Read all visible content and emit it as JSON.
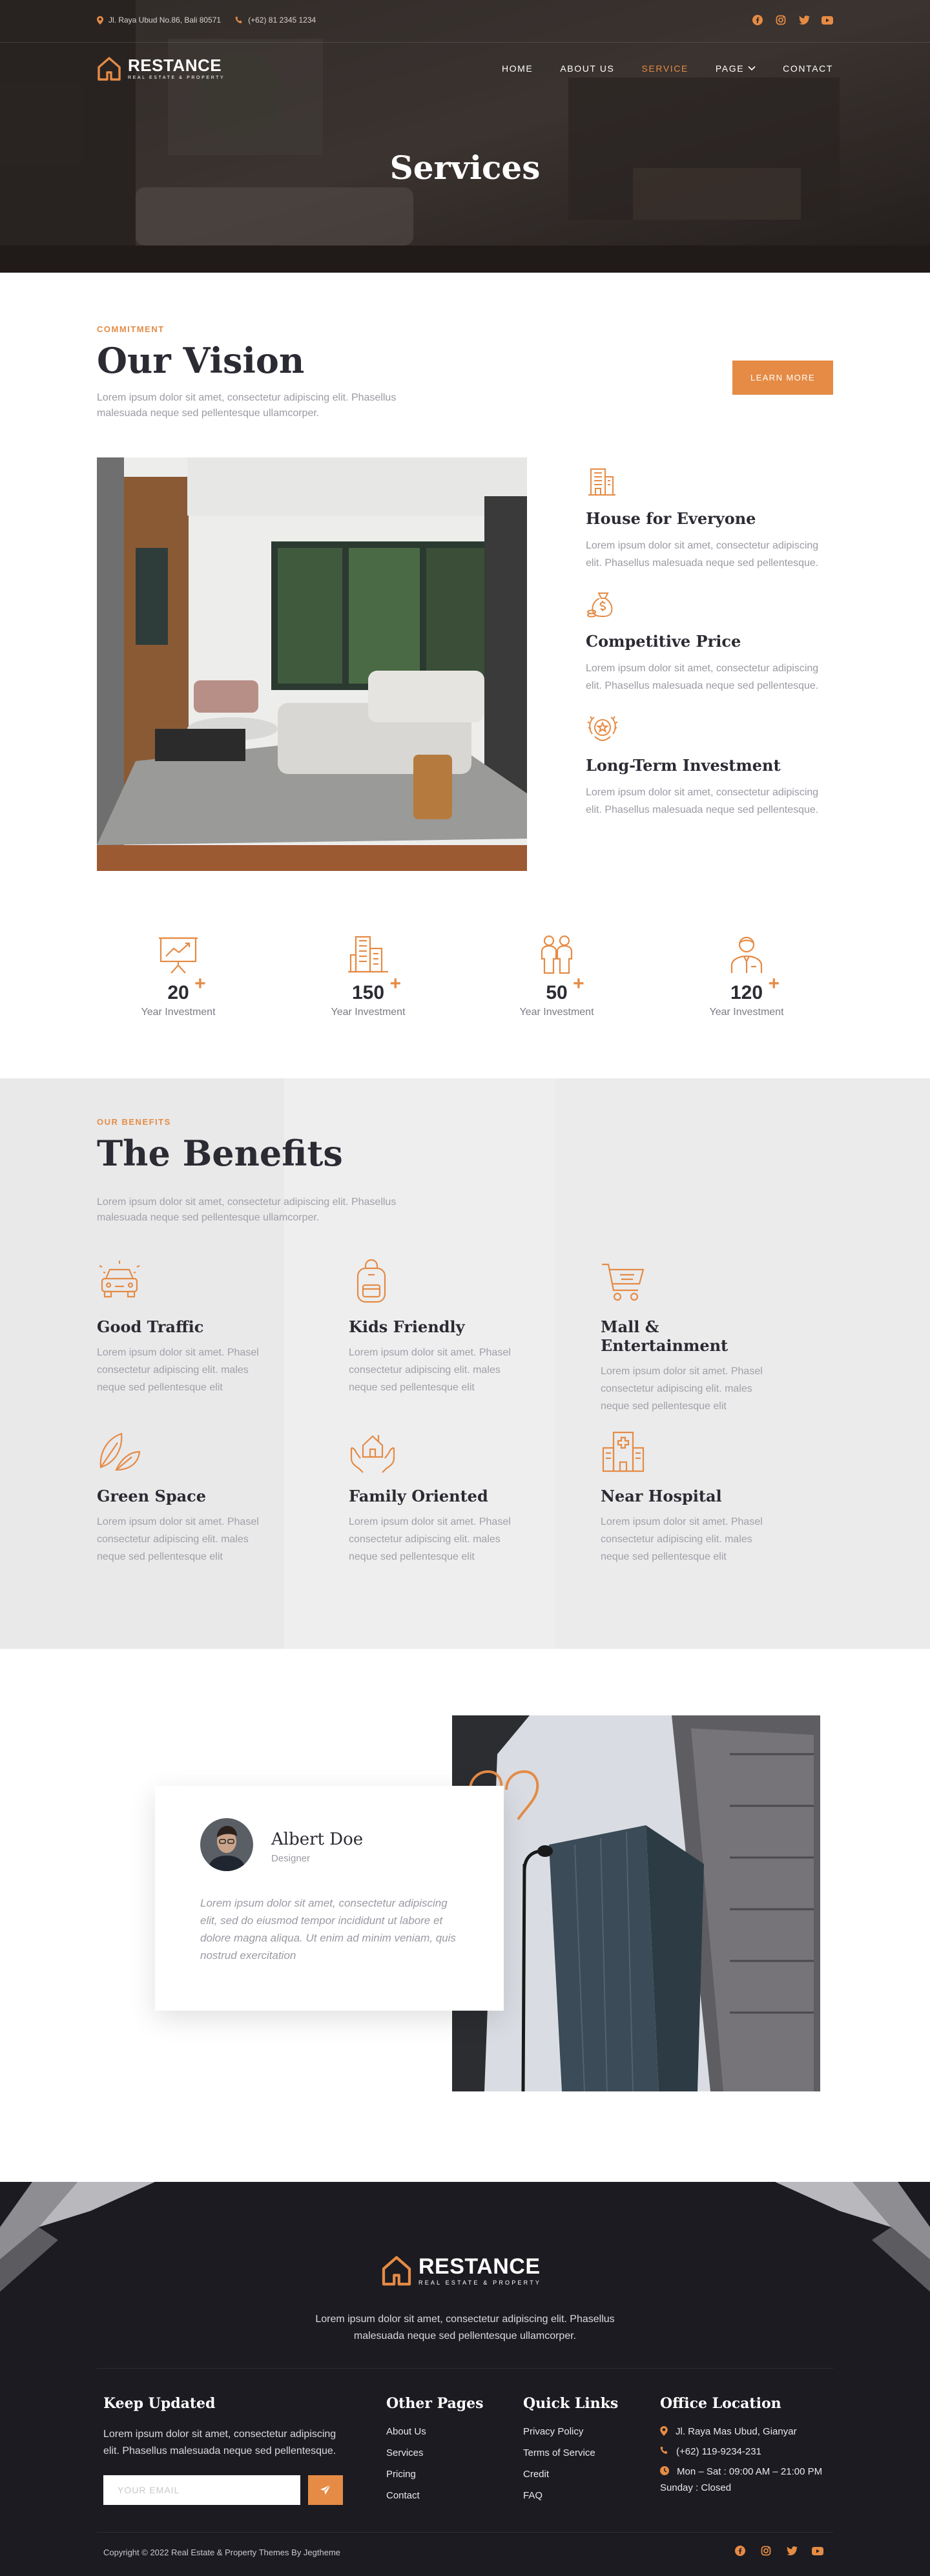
{
  "topbar": {
    "address": "Jl. Raya Ubud No.86, Bali 80571",
    "phone": "(+62) 81 2345 1234",
    "socials": [
      "facebook-icon",
      "instagram-icon",
      "twitter-icon",
      "youtube-icon"
    ]
  },
  "brand": {
    "name": "RESTANCE",
    "tagline": "REAL ESTATE & PROPERTY"
  },
  "nav": {
    "items": [
      {
        "label": "HOME"
      },
      {
        "label": "ABOUT US"
      },
      {
        "label": "SERVICE",
        "active": true
      },
      {
        "label": "PAGE",
        "dropdown": true
      },
      {
        "label": "CONTACT"
      }
    ]
  },
  "hero": {
    "title": "Services"
  },
  "vision": {
    "eyebrow": "COMMITMENT",
    "title": "Our Vision",
    "lead": "Lorem ipsum dolor sit amet, consectetur adipiscing elit. Phasellus malesuada neque sed pellentesque ullamcorper.",
    "button": "LEARN MORE",
    "features": [
      {
        "icon": "building-icon",
        "title": "House for Everyone",
        "text": "Lorem ipsum dolor sit amet, consectetur adipiscing elit. Phasellus malesuada neque sed pellentesque."
      },
      {
        "icon": "money-bag-icon",
        "title": "Competitive Price",
        "text": "Lorem ipsum dolor sit amet, consectetur adipiscing elit. Phasellus malesuada neque sed pellentesque."
      },
      {
        "icon": "award-icon",
        "title": "Long-Term Investment",
        "text": "Lorem ipsum dolor sit amet, consectetur adipiscing elit. Phasellus malesuada neque sed pellentesque."
      }
    ],
    "stats": [
      {
        "icon": "presentation-chart-icon",
        "value": "20",
        "label": "Year Investment"
      },
      {
        "icon": "city-buildings-icon",
        "value": "150",
        "label": "Year Investment"
      },
      {
        "icon": "people-icon",
        "value": "50",
        "label": "Year Investment"
      },
      {
        "icon": "businessman-icon",
        "value": "120",
        "label": "Year Investment"
      }
    ]
  },
  "benefits": {
    "eyebrow": "OUR BENEFITS",
    "title": "The Benefits",
    "lead": "Lorem ipsum dolor sit amet, consectetur adipiscing elit. Phasellus malesuada neque sed pellentesque ullamcorper.",
    "items": [
      {
        "icon": "car-icon",
        "title": "Good Traffic",
        "text": "Lorem ipsum dolor sit amet. Phasel consectetur adipiscing elit. males neque sed pellentesque elit"
      },
      {
        "icon": "backpack-icon",
        "title": "Kids Friendly",
        "text": "Lorem ipsum dolor sit amet. Phasel consectetur adipiscing elit. males neque sed pellentesque elit"
      },
      {
        "icon": "shopping-cart-icon",
        "title": "Mall & Entertainment",
        "text": "Lorem ipsum dolor sit amet. Phasel consectetur adipiscing elit. males neque sed pellentesque elit"
      },
      {
        "icon": "leaves-icon",
        "title": "Green Space",
        "text": "Lorem ipsum dolor sit amet. Phasel consectetur adipiscing elit. males neque sed pellentesque elit"
      },
      {
        "icon": "family-home-icon",
        "title": "Family Oriented",
        "text": "Lorem ipsum dolor sit amet. Phasel consectetur adipiscing elit. males neque sed pellentesque elit"
      },
      {
        "icon": "hospital-icon",
        "title": "Near Hospital",
        "text": "Lorem ipsum dolor sit amet. Phasel consectetur adipiscing elit. males neque sed pellentesque elit"
      }
    ]
  },
  "testimonial": {
    "name": "Albert Doe",
    "role": "Designer",
    "quote": "Lorem ipsum dolor sit amet, consectetur adipiscing elit, sed do eiusmod tempor incididunt ut labore et dolore magna aliqua. Ut enim ad minim veniam, quis nostrud exercitation"
  },
  "footer": {
    "tagline": "Lorem ipsum dolor sit amet, consectetur adipiscing elit. Phasellus malesuada neque sed pellentesque ullamcorper.",
    "newsletter": {
      "title": "Keep Updated",
      "text": "Lorem ipsum dolor sit amet, consectetur adipiscing elit. Phasellus malesuada neque sed pellentesque.",
      "placeholder": "YOUR EMAIL"
    },
    "other_pages": {
      "title": "Other Pages",
      "links": [
        "About Us",
        "Services",
        "Pricing",
        "Contact"
      ]
    },
    "quick_links": {
      "title": "Quick Links",
      "links": [
        "Privacy Policy",
        "Terms of Service",
        "Credit",
        "FAQ"
      ]
    },
    "office": {
      "title": "Office Location",
      "address": "Jl. Raya Mas Ubud, Gianyar",
      "phone": "(+62) 119-9234-231",
      "hours": "Mon – Sat : 09:00 AM – 21:00 PM",
      "sunday": "Sunday : Closed"
    },
    "copyright": "Copyright © 2022 Real Estate & Property Themes By Jegtheme"
  },
  "colors": {
    "accent": "#e58b45",
    "dark": "#1c1b21",
    "heading": "#2b2b33",
    "muted": "#9a9aa3"
  }
}
